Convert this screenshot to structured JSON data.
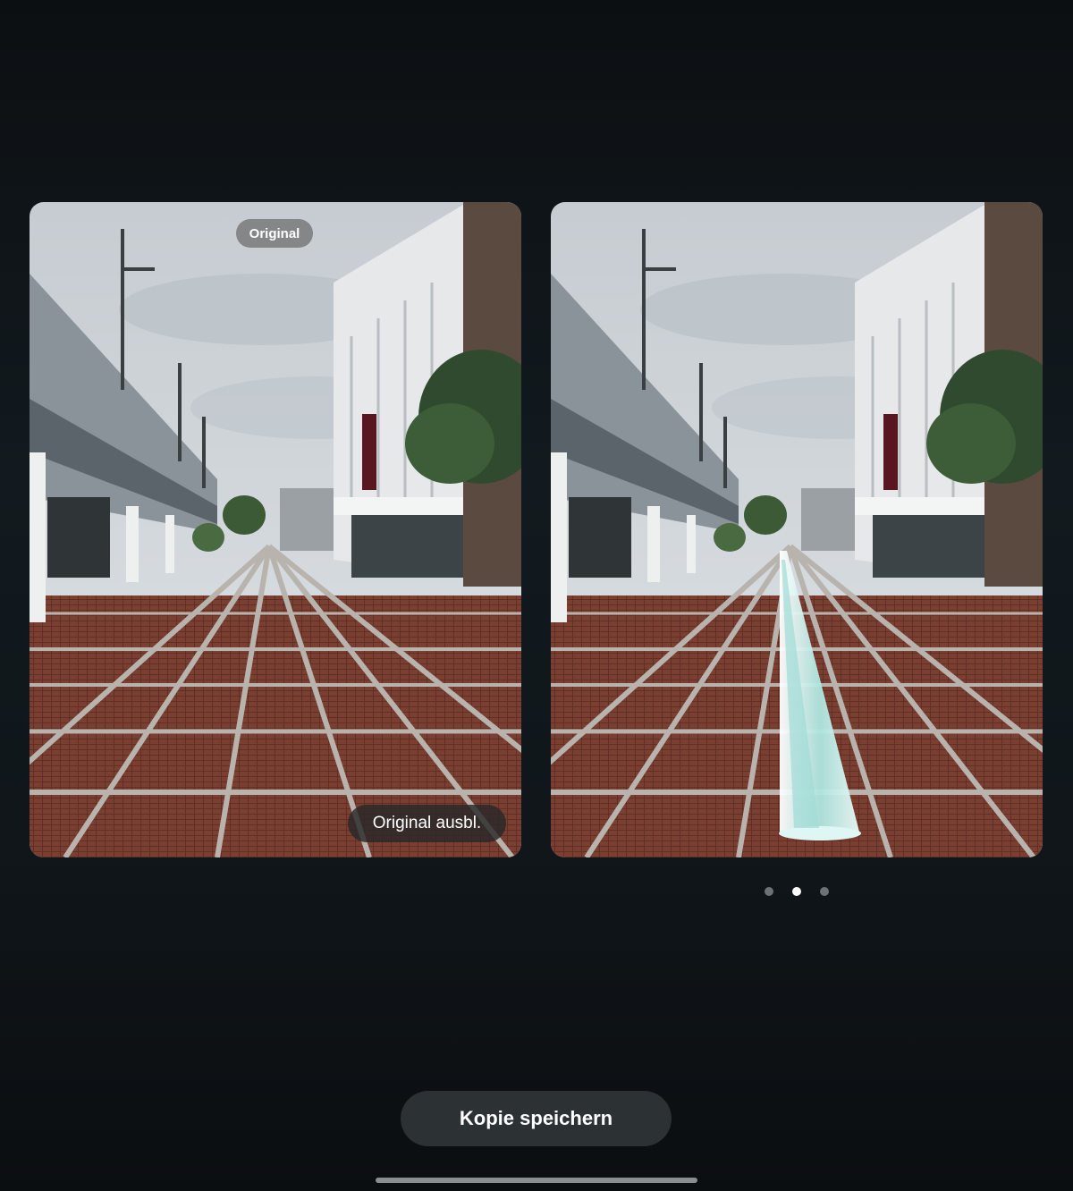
{
  "left_card": {
    "badge_label": "Original",
    "hide_button_label": "Original ausbl."
  },
  "pager": {
    "count": 3,
    "active_index": 1
  },
  "save_button_label": "Kopie speichern",
  "colors": {
    "background": "#10161a",
    "button_bg": "#2c3134",
    "slide_water": "#bfeee9"
  }
}
